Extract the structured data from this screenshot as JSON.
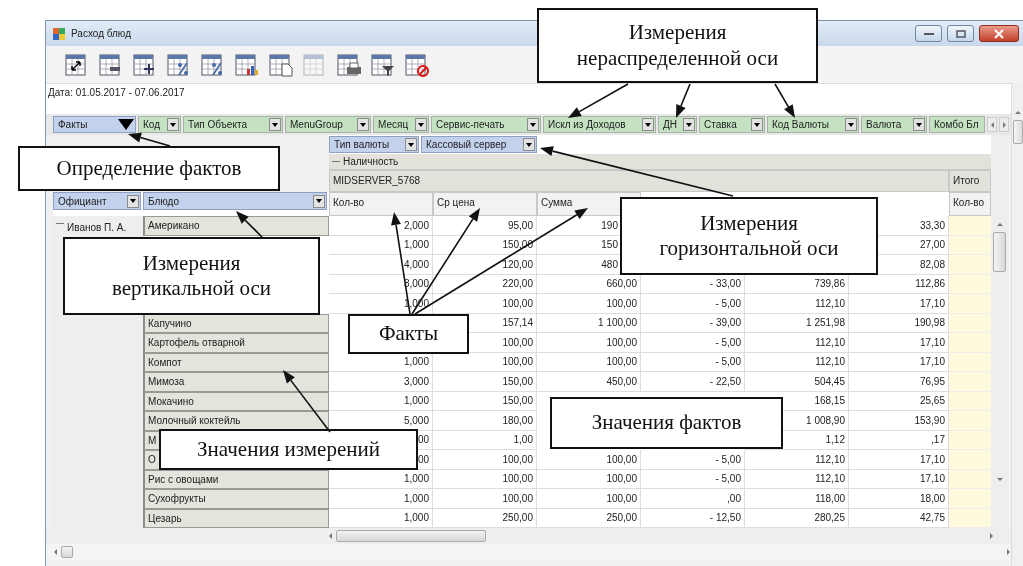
{
  "window": {
    "title": "Расход блюд"
  },
  "toolbar": [
    {
      "kind": "swap",
      "disabled": false
    },
    {
      "kind": "minus",
      "disabled": false
    },
    {
      "kind": "plus",
      "disabled": false
    },
    {
      "kind": "percent",
      "disabled": false
    },
    {
      "kind": "percent",
      "disabled": false
    },
    {
      "kind": "chart",
      "disabled": false
    },
    {
      "kind": "page",
      "disabled": false
    },
    {
      "kind": "plain",
      "disabled": true
    },
    {
      "kind": "print",
      "disabled": false
    },
    {
      "kind": "filter",
      "disabled": false
    },
    {
      "kind": "delete",
      "disabled": false
    }
  ],
  "date_range": "Дата: 01.05.2017 - 07.06.2017",
  "filter_fields": [
    {
      "label": "Факты",
      "kind": "facts",
      "truncated": false
    },
    {
      "label": "Код",
      "kind": "dimension",
      "truncated": false
    },
    {
      "label": "Тип Объекта",
      "kind": "dimension",
      "truncated": false
    },
    {
      "label": "MenuGroup",
      "kind": "dimension",
      "truncated": false
    },
    {
      "label": "Месяц",
      "kind": "dimension",
      "truncated": false
    },
    {
      "label": "Сервис-печать",
      "kind": "dimension",
      "truncated": false
    },
    {
      "label": "Искл из Доходов",
      "kind": "dimension",
      "truncated": false
    },
    {
      "label": "ДН",
      "kind": "dimension",
      "truncated": false
    },
    {
      "label": "Ставка",
      "kind": "dimension",
      "truncated": false
    },
    {
      "label": "Код Валюты",
      "kind": "dimension",
      "truncated": false
    },
    {
      "label": "Валюта",
      "kind": "dimension",
      "truncated": false
    },
    {
      "label": "Комбо Бл",
      "kind": "dimension",
      "truncated": true
    }
  ],
  "column_fields": [
    {
      "label": "Тип валюты"
    },
    {
      "label": "Кассовый сервер"
    }
  ],
  "row_fields": [
    {
      "label": "Официант"
    },
    {
      "label": "Блюдо"
    }
  ],
  "column_header": {
    "group": {
      "label": "Наличность",
      "expanded": true
    },
    "server": "MIDSERVER_5768",
    "total": "Итого"
  },
  "columns": [
    "Кол-во",
    "Ср цена",
    "Сумма"
  ],
  "total_columns": [
    "Кол-во"
  ],
  "row_group": {
    "label": "Иванов П. А.",
    "expanded": true
  },
  "rows": [
    {
      "dish": "Американо",
      "qty": "2,000",
      "avg_price": "95,00",
      "sum_partial": "190",
      "column_6": "33,30"
    },
    {
      "qty": "1,000",
      "avg_price": "150,00",
      "sum_partial": "150",
      "column_6": "27,00"
    },
    {
      "qty": "4,000",
      "avg_price": "120,00",
      "sum_partial": "480",
      "column_6": "82,08"
    },
    {
      "qty": "3,000",
      "avg_price": "220,00",
      "sum": "660,00",
      "column_4": "- 33,00",
      "column_5": "739,86",
      "column_6": "112,86"
    },
    {
      "qty": "1,000",
      "avg_price": "100,00",
      "sum": "100,00",
      "column_4": "- 5,00",
      "column_5": "112,10",
      "column_6": "17,10"
    },
    {
      "dish": "Капучино",
      "avg_price": "157,14",
      "sum": "1 100,00",
      "column_4": "- 39,00",
      "column_5": "1 251,98",
      "column_6": "190,98"
    },
    {
      "dish": "Картофель отварной",
      "avg_price": "100,00",
      "sum": "100,00",
      "column_4": "- 5,00",
      "column_5": "112,10",
      "column_6": "17,10"
    },
    {
      "dish": "Компот",
      "qty": "1,000",
      "avg_price": "100,00",
      "sum": "100,00",
      "column_4": "- 5,00",
      "column_5": "112,10",
      "column_6": "17,10"
    },
    {
      "dish": "Мимоза",
      "qty": "3,000",
      "avg_price": "150,00",
      "sum": "450,00",
      "column_4": "- 22,50",
      "column_5": "504,45",
      "column_6": "76,95"
    },
    {
      "dish": "Мокачино",
      "qty": "1,000",
      "avg_price": "150,00",
      "column_5": "168,15",
      "column_6": "25,65"
    },
    {
      "dish": "Молочный коктейль",
      "qty": "5,000",
      "avg_price": "180,00",
      "column_5": "1 008,90",
      "column_6": "153,90"
    },
    {
      "dish": "М",
      "qty": "00",
      "avg_price": "1,00",
      "column_5": "1,12",
      "column_6": ",17"
    },
    {
      "dish": "О",
      "qty": "00",
      "avg_price": "100,00",
      "sum": "100,00",
      "column_4": "- 5,00",
      "column_5": "112,10",
      "column_6": "17,10"
    },
    {
      "dish": "Рис с овощами",
      "qty": "1,000",
      "avg_price": "100,00",
      "sum": "100,00",
      "column_4": "- 5,00",
      "column_5": "112,10",
      "column_6": "17,10"
    },
    {
      "dish": "Сухофрукты",
      "qty": "1,000",
      "avg_price": "100,00",
      "sum": "100,00",
      "column_4": ",00",
      "column_5": "118,00",
      "column_6": "18,00"
    },
    {
      "dish": "Цезарь",
      "qty": "1,000",
      "avg_price": "250,00",
      "sum": "250,00",
      "column_4": "- 12,50",
      "column_5": "280,25",
      "column_6": "42,75"
    }
  ],
  "callouts": [
    "Измерения\nнераспределенной оси",
    "Определение фактов",
    "Измерения\nгоризонтальной оси",
    "Измерения\nвертикальной оси",
    "Факты",
    "Значения фактов",
    "Значения измерений"
  ]
}
